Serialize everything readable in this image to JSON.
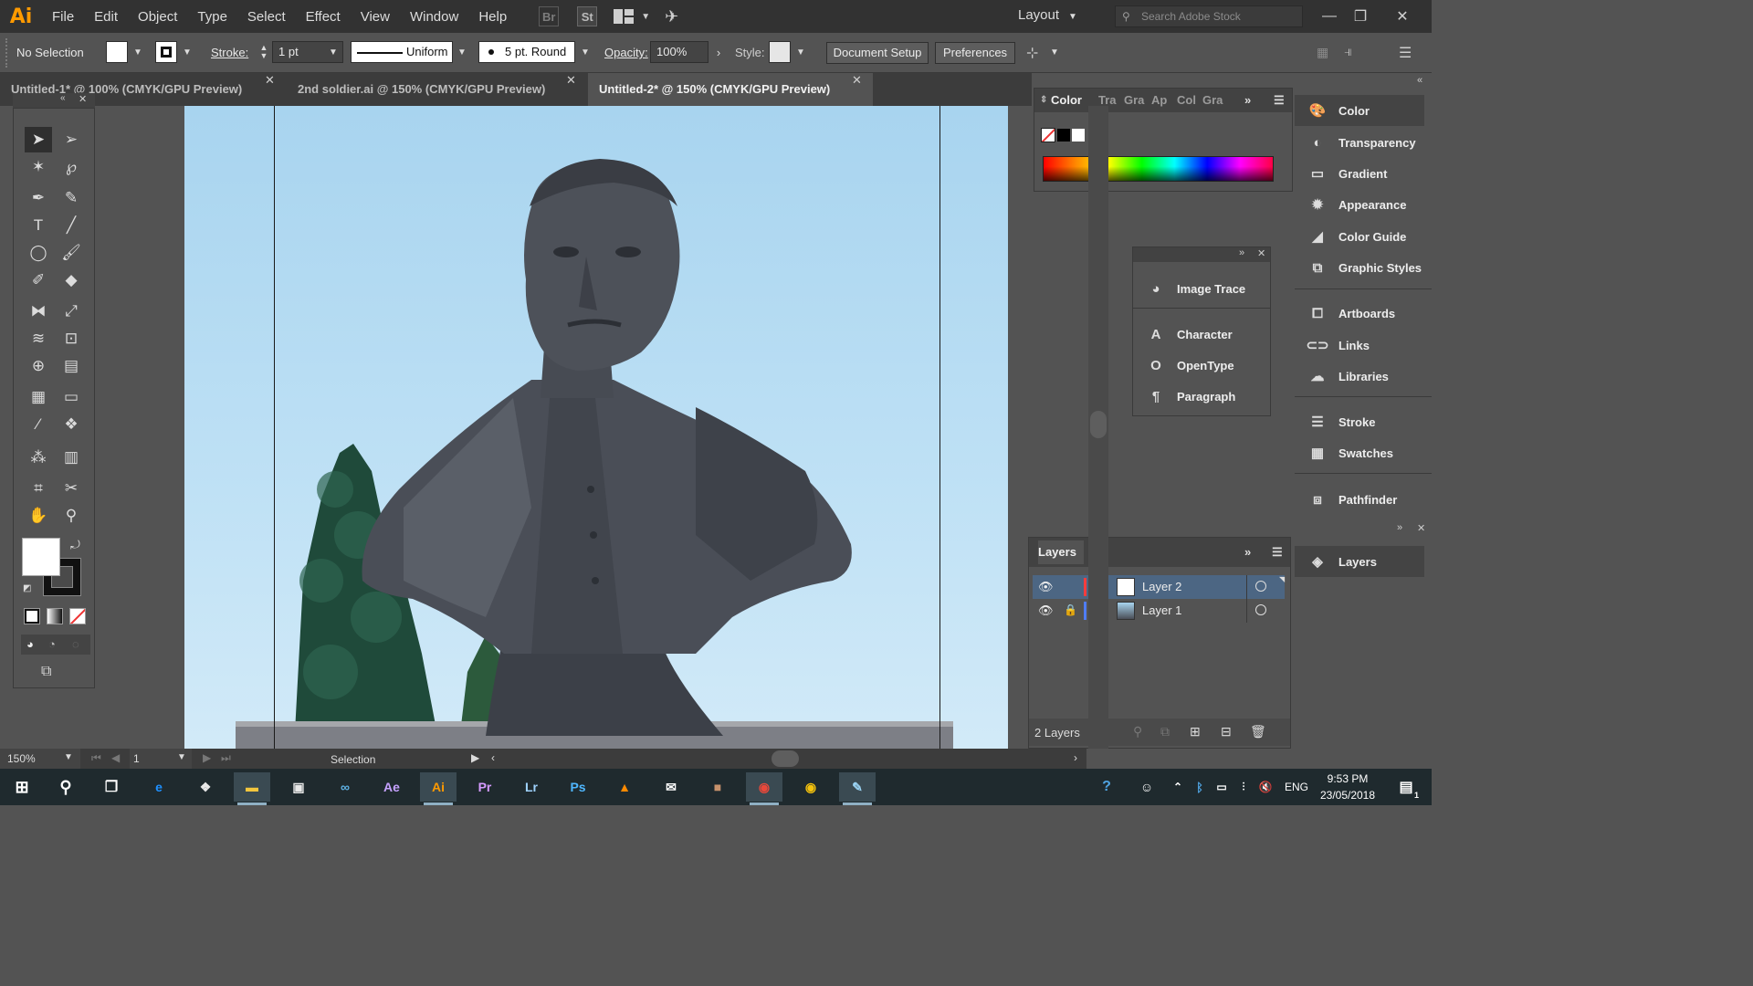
{
  "app": {
    "logo": "Ai"
  },
  "menu": [
    "File",
    "Edit",
    "Object",
    "Type",
    "Select",
    "Effect",
    "View",
    "Window",
    "Help"
  ],
  "menu_badges": {
    "bridge": "Br",
    "stock": "St"
  },
  "workspace": {
    "label": "Layout"
  },
  "search": {
    "placeholder": "Search Adobe Stock"
  },
  "control_bar": {
    "selection": "No Selection",
    "stroke_label": "Stroke:",
    "stroke_weight": "1 pt",
    "profile": "Uniform",
    "brush": "5 pt. Round",
    "opacity_label": "Opacity:",
    "opacity": "100%",
    "style_label": "Style:",
    "document_setup": "Document Setup",
    "preferences": "Preferences"
  },
  "tabs": [
    {
      "title": "Untitled-1* @ 100% (CMYK/GPU Preview)",
      "active": false
    },
    {
      "title": "2nd soldier.ai @ 150% (CMYK/GPU Preview)",
      "active": false
    },
    {
      "title": "Untitled-2* @ 150% (CMYK/GPU Preview)",
      "active": true
    }
  ],
  "color_panel": {
    "tabs": [
      "Color",
      "Tra",
      "Gra",
      "Ap",
      "Col",
      "Gra"
    ]
  },
  "float_panel": {
    "items": [
      "Image Trace",
      "Character",
      "OpenType",
      "Paragraph"
    ]
  },
  "dock": {
    "items": [
      "Color",
      "Transparency",
      "Gradient",
      "Appearance",
      "Color Guide",
      "Graphic Styles",
      "Artboards",
      "Links",
      "Libraries",
      "Stroke",
      "Swatches",
      "Pathfinder"
    ],
    "layers_item": "Layers"
  },
  "layers": {
    "title": "Layers",
    "rows": [
      {
        "name": "Layer 2",
        "color": "#ff3c3c",
        "selected": true
      },
      {
        "name": "Layer 1",
        "color": "#4f7df5",
        "selected": false
      }
    ],
    "count": "2 Layers"
  },
  "status": {
    "zoom": "150%",
    "artboard": "1",
    "tool": "Selection"
  },
  "taskbar": {
    "apps": [
      {
        "name": "ie",
        "label": "e",
        "color": "#1e90ff"
      },
      {
        "name": "dropbox",
        "label": "❖",
        "color": "#e8e8e8"
      },
      {
        "name": "explorer",
        "label": "▬",
        "color": "#f2c53d"
      },
      {
        "name": "store",
        "label": "▣",
        "color": "#e8e8e8"
      },
      {
        "name": "infinity",
        "label": "∞",
        "color": "#5fb3e6"
      },
      {
        "name": "after-effects",
        "label": "Ae",
        "color": "#c6a2ff"
      },
      {
        "name": "illustrator",
        "label": "Ai",
        "color": "#ff9a00"
      },
      {
        "name": "premiere",
        "label": "Pr",
        "color": "#d59bff"
      },
      {
        "name": "lightroom",
        "label": "Lr",
        "color": "#9fd3ff"
      },
      {
        "name": "photoshop",
        "label": "Ps",
        "color": "#4fb7ff"
      },
      {
        "name": "vlc",
        "label": "▲",
        "color": "#ff8a00"
      },
      {
        "name": "mail",
        "label": "✉",
        "color": "#ffffff"
      },
      {
        "name": "photo-app",
        "label": "■",
        "color": "#c7926c"
      },
      {
        "name": "chrome",
        "label": "◉",
        "color": "#e9483a"
      },
      {
        "name": "chrome-2",
        "label": "◉",
        "color": "#f4c20d"
      },
      {
        "name": "paint",
        "label": "✎",
        "color": "#9ad2f2"
      }
    ],
    "language": "ENG",
    "time": "9:53 PM",
    "date": "23/05/2018",
    "notifications": "1"
  }
}
